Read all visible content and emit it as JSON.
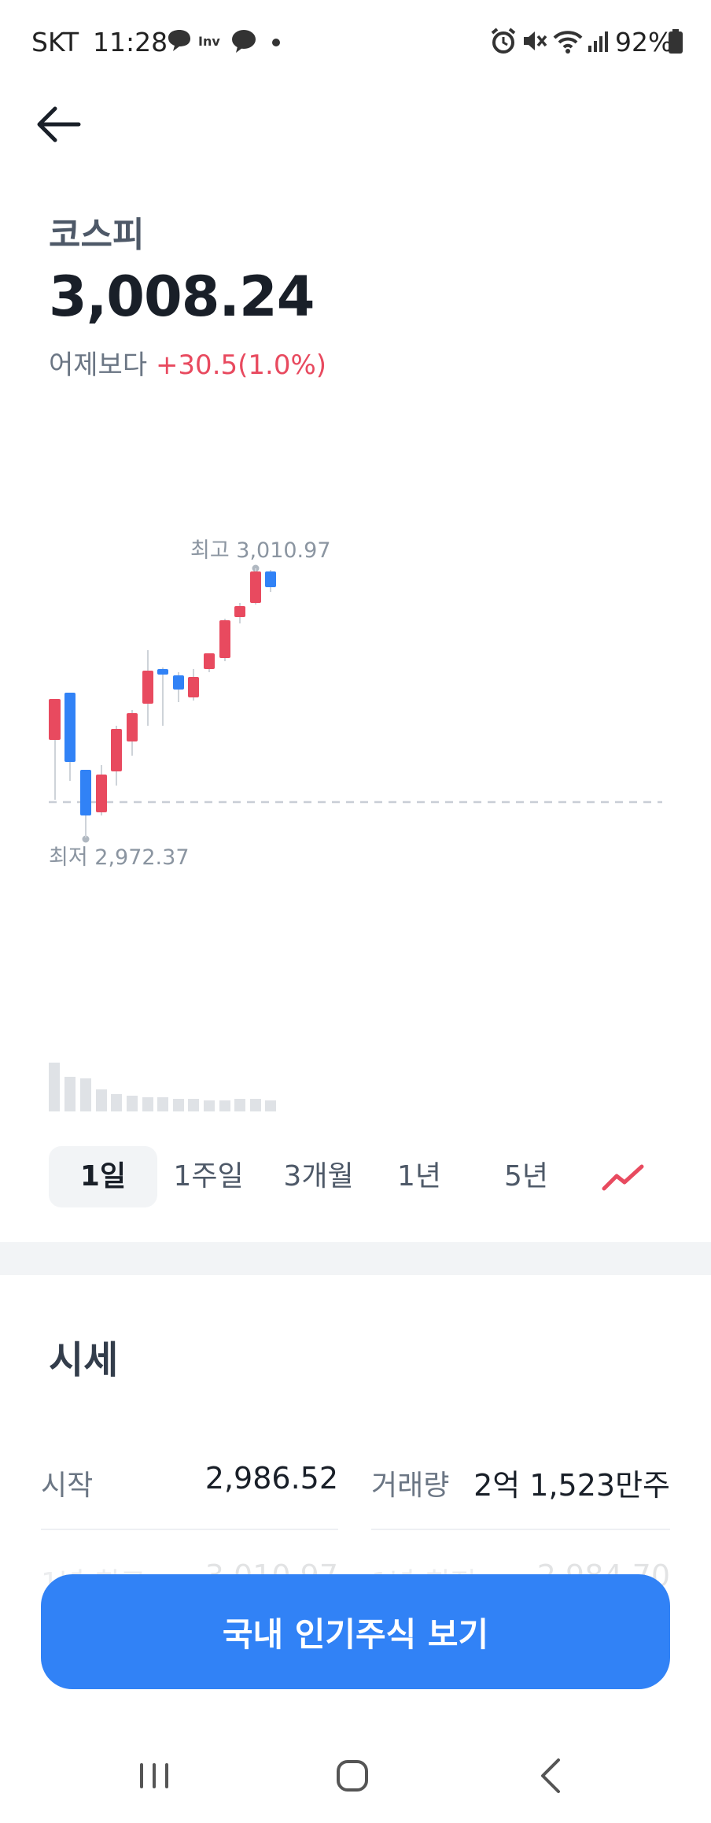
{
  "status_bar": {
    "carrier": "SKT",
    "time": "11:28",
    "battery": "92%"
  },
  "header": {
    "index_name": "코스피",
    "index_value": "3,008.24",
    "change_label": "어제보다",
    "change_value": "+30.5(1.0%)"
  },
  "chart": {
    "high_label": "최고 3,010.97",
    "low_label": "최저 2,972.37"
  },
  "chart_data": {
    "type": "candlestick",
    "high": 3010.97,
    "low": 2972.37,
    "previous_close": 2977.74,
    "colors": {
      "up": "#e84a5f",
      "down": "#3182f6"
    }
  },
  "tabs": [
    {
      "label": "1일",
      "active": true
    },
    {
      "label": "1주일",
      "active": false
    },
    {
      "label": "3개월",
      "active": false
    },
    {
      "label": "1년",
      "active": false
    },
    {
      "label": "5년",
      "active": false
    }
  ],
  "section": {
    "title": "시세"
  },
  "stats": {
    "open_label": "시작",
    "open_value": "2,986.52",
    "volume_label": "거래량",
    "volume_value": "2억 1,523만주",
    "hidden_left_label": "1년 최고",
    "hidden_left_value": "3,010.97",
    "hidden_right_label": "1년 최저",
    "hidden_right_value": "2,984.70"
  },
  "cta": {
    "label": "국내 인기주식 보기"
  },
  "colors": {
    "accent": "#3182f6",
    "up": "#e84a5f",
    "down": "#3182f6"
  }
}
